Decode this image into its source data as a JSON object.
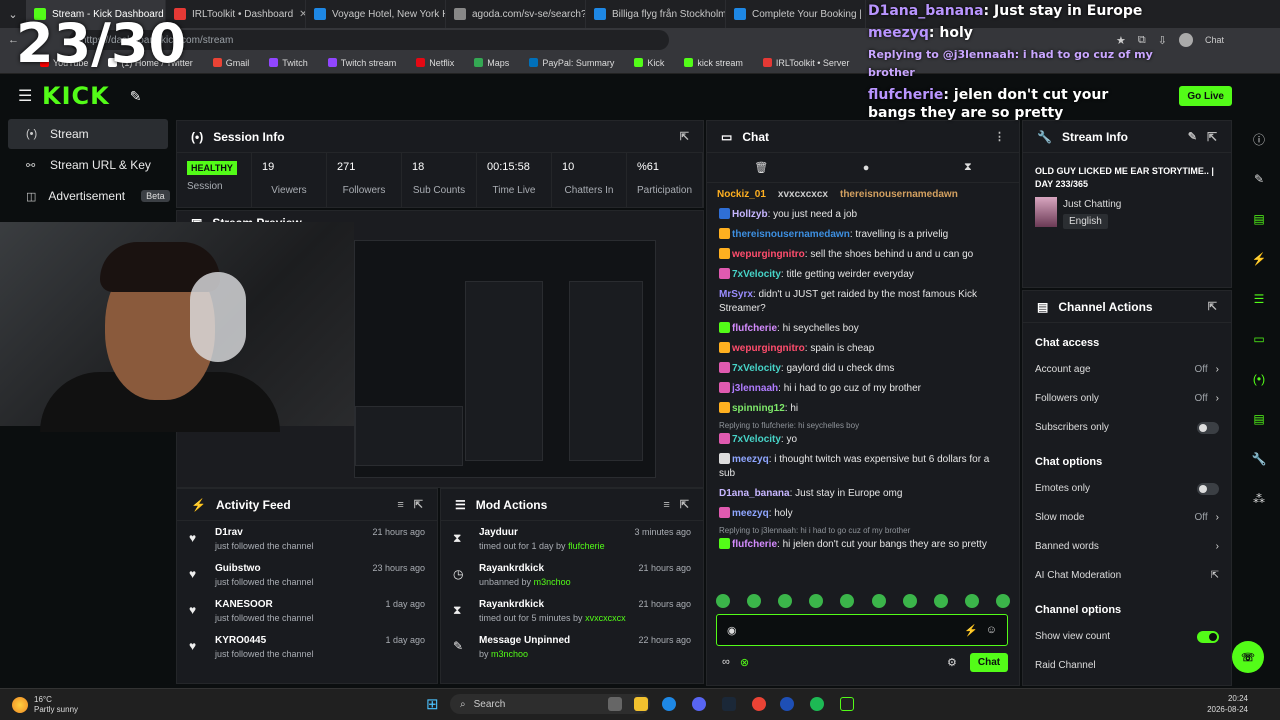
{
  "browser": {
    "tabs": [
      {
        "title": "Stream - Kick Dashboard",
        "color": "#53fc18"
      },
      {
        "title": "IRLToolkit • Dashboard",
        "color": "#e53935"
      },
      {
        "title": "Voyage Hotel, New York Ho",
        "color": "#1e88e5"
      },
      {
        "title": "agoda.com/sv-se/search?ci",
        "color": "#888888"
      },
      {
        "title": "Billiga flyg från Stockholm til",
        "color": "#1e88e5"
      },
      {
        "title": "Complete Your Booking | Sn",
        "color": "#1e88e5"
      }
    ],
    "url": "https://dashboard.kick.com/stream",
    "bookmarks": [
      {
        "label": "YouTube",
        "color": "#ff0000"
      },
      {
        "label": "(1) Home / Twitter",
        "color": "#ffffff"
      },
      {
        "label": "Gmail",
        "color": "#ea4335"
      },
      {
        "label": "Twitch",
        "color": "#9146ff"
      },
      {
        "label": "Twitch stream",
        "color": "#9146ff"
      },
      {
        "label": "Netflix",
        "color": "#e50914"
      },
      {
        "label": "Maps",
        "color": "#34a853"
      },
      {
        "label": "PayPal: Summary",
        "color": "#0070ba"
      },
      {
        "label": "Kick",
        "color": "#53fc18"
      },
      {
        "label": "kick stream",
        "color": "#53fc18"
      },
      {
        "label": "IRLToolkit • Server",
        "color": "#e53935"
      }
    ],
    "chat_label": "Chat"
  },
  "counter": "23/30",
  "overlay": [
    {
      "user": "D1ana_banana",
      "text": "Just stay in Europe"
    },
    {
      "user": "meezyq",
      "text": "holy"
    },
    {
      "reply": "Replying to @j3lennaah: i had to go cuz of my brother"
    },
    {
      "user": "flufcherie",
      "text": "jelen don't cut your bangs they are so pretty"
    }
  ],
  "app": {
    "logo": "KICK",
    "go_live": "Go Live",
    "nav": [
      {
        "label": "Stream",
        "icon": "(•)"
      },
      {
        "label": "Stream URL & Key",
        "icon": "⚯"
      },
      {
        "label": "Advertisement",
        "icon": "◫",
        "badge": "Beta"
      }
    ]
  },
  "session": {
    "title": "Session Info",
    "health": "HEALTHY",
    "stats": [
      {
        "value": "",
        "label": "Session"
      },
      {
        "value": "19",
        "label": "Viewers"
      },
      {
        "value": "271",
        "label": "Followers"
      },
      {
        "value": "18",
        "label": "Sub Counts"
      },
      {
        "value": "00:15:58",
        "label": "Time Live"
      },
      {
        "value": "10",
        "label": "Chatters In"
      },
      {
        "value": "%61",
        "label": "Participation"
      }
    ]
  },
  "preview": {
    "title": "Stream Preview"
  },
  "activity": {
    "title": "Activity Feed",
    "items": [
      {
        "name": "D1rav",
        "sub": "just followed the channel",
        "ago": "21 hours ago"
      },
      {
        "name": "Guibstwo",
        "sub": "just followed the channel",
        "ago": "23 hours ago"
      },
      {
        "name": "KANESOOR",
        "sub": "just followed the channel",
        "ago": "1 day ago"
      },
      {
        "name": "KYRO0445",
        "sub": "just followed the channel",
        "ago": "1 day ago"
      }
    ]
  },
  "mod": {
    "title": "Mod Actions",
    "items": [
      {
        "name": "Jayduur",
        "sub": "timed out for 1 day by",
        "by": "flufcherie",
        "ago": "3 minutes ago",
        "icon": "⧗"
      },
      {
        "name": "Rayankrdkick",
        "sub": "unbanned by",
        "by": "m3nchoo",
        "ago": "21 hours ago",
        "icon": "◷"
      },
      {
        "name": "Rayankrdkick",
        "sub": "timed out for 5 minutes by",
        "by": "xvxcxcxcx",
        "ago": "21 hours ago",
        "icon": "⧗"
      },
      {
        "name": "Message Unpinned",
        "sub": "by",
        "by": "m3nchoo",
        "ago": "22 hours ago",
        "icon": "✎"
      }
    ]
  },
  "chat": {
    "title": "Chat",
    "pinned": [
      "Nockiz_01",
      "xvxcxcxcx",
      "thereisnousernamedawn"
    ],
    "messages": [
      {
        "user": "Hollzyb",
        "color": "#c7b6ff",
        "text": "you just need a job",
        "badge": "#2f6fd6"
      },
      {
        "user": "thereisnousernamedawn",
        "color": "#3d8fe0",
        "text": "travelling is a privelig",
        "badge": "#ffb020"
      },
      {
        "user": "wepurgingnitro",
        "color": "#ff4d6d",
        "text": "sell the shoes behind u and u can go",
        "badge": "#ffb020"
      },
      {
        "user": "7xVelocity",
        "color": "#47d4c8",
        "text": "title getting weirder everyday",
        "badge": "#e05ab0"
      },
      {
        "user": "MrSyrx",
        "color": "#9a8cff",
        "text": "didn't u JUST get raided by the most famous Kick Streamer?",
        "badge": ""
      },
      {
        "user": "flufcherie",
        "color": "#d58cff",
        "text": "hi seychelles boy",
        "badge": "#53fc18"
      },
      {
        "user": "wepurgingnitro",
        "color": "#ff4d6d",
        "text": "spain is cheap",
        "badge": "#ffb020"
      },
      {
        "user": "7xVelocity",
        "color": "#47d4c8",
        "text": "gaylord did u check dms",
        "badge": "#e05ab0"
      },
      {
        "user": "j3lennaah",
        "color": "#b07cff",
        "text": "hi i had to go cuz of my brother",
        "badge": "#e05ab0"
      },
      {
        "user": "spinning12",
        "color": "#7ee86a",
        "text": "hi",
        "badge": "#ffb020"
      },
      {
        "reply": "Replying to flufcherie: hi seychelles boy"
      },
      {
        "user": "7xVelocity",
        "color": "#47d4c8",
        "text": "yo",
        "badge": "#e05ab0"
      },
      {
        "user": "meezyq",
        "color": "#8fa6ff",
        "text": "i thought twitch was expensive but 6 dollars for a sub",
        "badge": "#dddddd"
      },
      {
        "user": "D1ana_banana",
        "color": "#c7b6ff",
        "text": "Just stay in Europe omg",
        "badge": ""
      },
      {
        "user": "meezyq",
        "color": "#8fa6ff",
        "text": "holy",
        "badge": "#e05ab0"
      },
      {
        "reply": "Replying to j3lennaah: hi i had to go cuz of my brother"
      },
      {
        "user": "flufcherie",
        "color": "#d58cff",
        "text": "hi jelen don't cut your bangs they are so pretty",
        "badge": "#53fc18"
      }
    ],
    "input_value": "",
    "send_label": "Chat"
  },
  "stream_info": {
    "title": "Stream Info",
    "stream_title": "OLD GUY LICKED ME EAR STORYTIME.. | DAY 233/365",
    "category": "Just Chatting",
    "language": "English"
  },
  "channel_actions": {
    "title": "Channel Actions",
    "chat_access": "Chat access",
    "chat_options": "Chat options",
    "channel_options": "Channel options",
    "account_age": {
      "label": "Account age",
      "value": "Off"
    },
    "followers_only": {
      "label": "Followers only",
      "value": "Off"
    },
    "subscribers_only": {
      "label": "Subscribers only"
    },
    "emotes_only": {
      "label": "Emotes only"
    },
    "slow_mode": {
      "label": "Slow mode",
      "value": "Off"
    },
    "banned_words": {
      "label": "Banned words"
    },
    "ai_moderation": {
      "label": "AI Chat Moderation"
    },
    "show_view_count": {
      "label": "Show view count"
    },
    "raid_channel": {
      "label": "Raid Channel"
    }
  },
  "taskbar": {
    "temp": "16°C",
    "weather": "Partly sunny",
    "search": "Search",
    "time": "20:24",
    "date": "2026-08-24"
  },
  "colors": {
    "accent": "#53fc18",
    "panel": "#191b1f",
    "bg": "#0b0e0f"
  }
}
